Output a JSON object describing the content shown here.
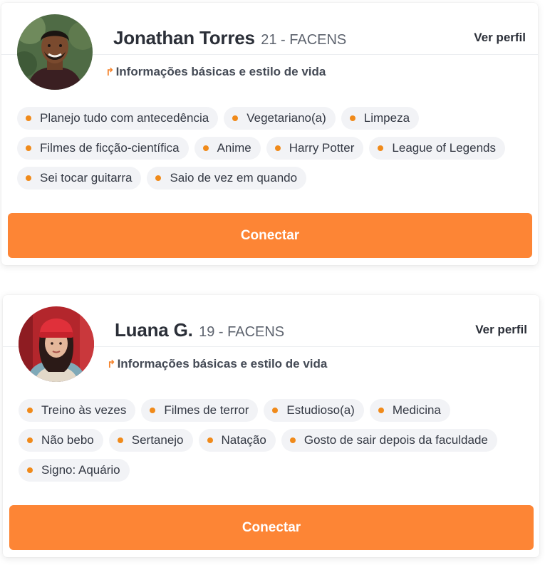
{
  "colors": {
    "accent": "#fd8535",
    "dot": "#f08a1a",
    "tag_bg": "#f2f3f6",
    "text": "#2b2f38"
  },
  "profiles": [
    {
      "name": "Jonathan Torres",
      "meta": "21 - FACENS",
      "view_profile": "Ver perfil",
      "subtitle_icon": "arrow-return-icon",
      "subtitle": "Informações básicas e estilo de vida",
      "tags": [
        "Planejo tudo com antecedência",
        "Vegetariano(a)",
        "Limpeza",
        "Filmes de ficção-científica",
        "Anime",
        "Harry Potter",
        "League of Legends",
        "Sei tocar guitarra",
        "Saio de vez em quando"
      ],
      "connect_label": "Conectar"
    },
    {
      "name": "Luana G.",
      "meta": "19 - FACENS",
      "view_profile": "Ver perfil",
      "subtitle_icon": "arrow-return-icon",
      "subtitle": "Informações básicas e estilo de vida",
      "tags": [
        "Treino às vezes",
        "Filmes de terror",
        "Estudioso(a)",
        "Medicina",
        "Não bebo",
        "Sertanejo",
        "Natação",
        "Gosto de sair depois da faculdade",
        "Signo: Aquário"
      ],
      "connect_label": "Conectar"
    }
  ]
}
